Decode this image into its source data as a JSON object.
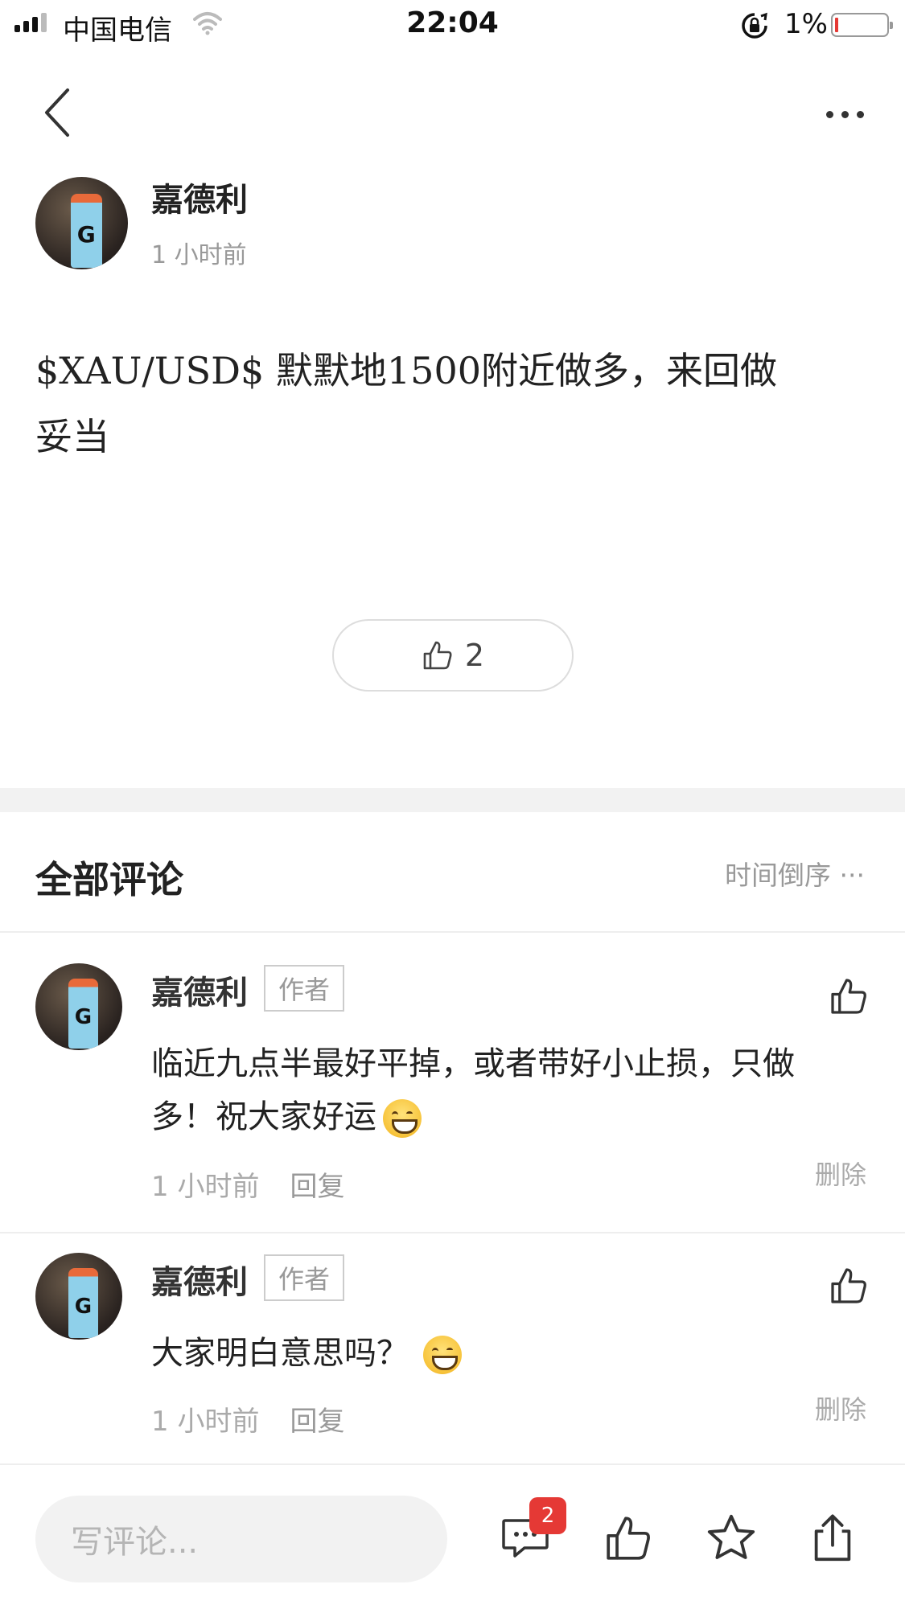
{
  "status_bar": {
    "carrier": "中国电信",
    "time": "22:04",
    "battery_percent": "1%",
    "battery_level": 0.01,
    "signal_icon": "cellular-signal-icon",
    "wifi_icon": "wifi-icon",
    "lock_icon": "orientation-lock-icon"
  },
  "nav": {
    "back_icon": "chevron-left-icon",
    "more_icon": "more-horizontal-icon"
  },
  "post": {
    "author": "嘉德利",
    "time": "1 小时前",
    "body_line1": "$XAU/USD$ 默默地1500附近做多，来回做",
    "body_line2": "妥当",
    "like_icon": "thumbs-up-icon",
    "like_count": "2"
  },
  "comments_section": {
    "title": "全部评论",
    "sort_label": "时间倒序 ···"
  },
  "comments": [
    {
      "author": "嘉德利",
      "badge": "作者",
      "text_line1": "临近九点半最好平掉，或者带好小止损，只做",
      "text_line2": "多！祝大家好运",
      "emoji": "grinning-face-emoji",
      "time": "1 小时前",
      "reply": "回复",
      "delete": "删除"
    },
    {
      "author": "嘉德利",
      "badge": "作者",
      "text_line1": "大家明白意思吗？",
      "emoji": "grinning-face-emoji",
      "time": "1 小时前",
      "reply": "回复",
      "delete": "删除"
    }
  ],
  "bottom_bar": {
    "input_placeholder": "写评论...",
    "comment_icon": "comment-bubble-icon",
    "comment_count": "2",
    "like_icon": "thumbs-up-icon",
    "favorite_icon": "star-icon",
    "share_icon": "share-icon"
  },
  "colors": {
    "badge_red": "#e53935",
    "text_primary": "#222222",
    "text_secondary": "#999999",
    "divider": "#eeeeee"
  }
}
